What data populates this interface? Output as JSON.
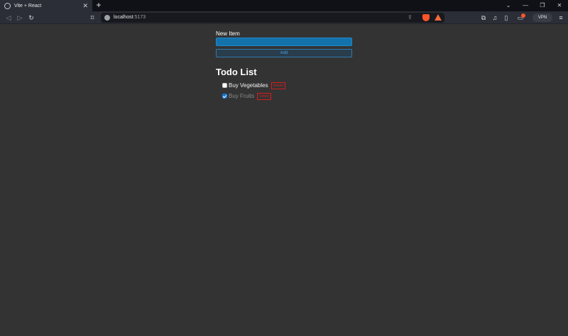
{
  "browser": {
    "tab_title": "Vite + React",
    "new_tab_label": "+",
    "url_host": "localhost",
    "url_port": ":5173",
    "vpn_label": "VPN"
  },
  "form": {
    "label": "New Item",
    "input_value": "",
    "add_label": "Add"
  },
  "todo": {
    "title": "Todo List",
    "items": [
      {
        "text": "Buy Vegetables",
        "done": false,
        "delete_label": "Delete"
      },
      {
        "text": "Buy Fruits",
        "done": true,
        "delete_label": "Delete"
      }
    ]
  },
  "colors": {
    "background": "#333333",
    "input_fill": "#1472ab",
    "add_button_text": "#46a2e6",
    "delete_red": "#d01f1f"
  }
}
